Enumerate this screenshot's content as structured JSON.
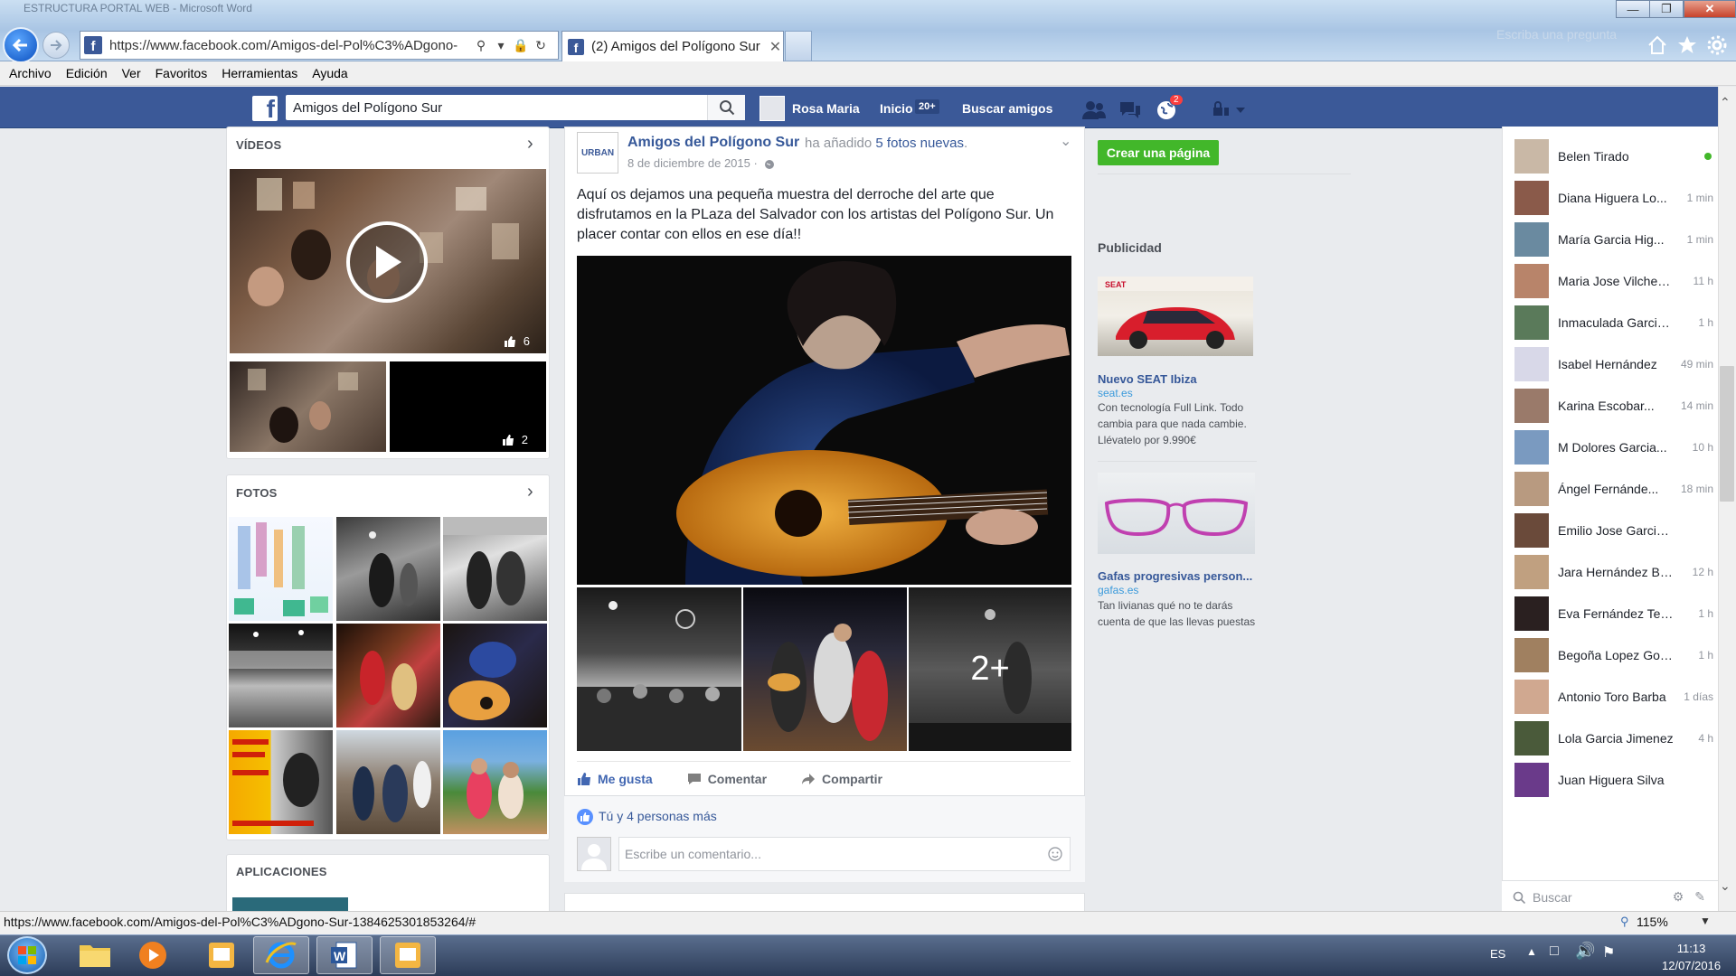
{
  "window": {
    "title": "ESTRUCTURA PORTAL WEB - Microsoft Word"
  },
  "browser": {
    "url": "https://www.facebook.com/Amigos-del-Pol%C3%ADgono-",
    "tab_title": "(2) Amigos del Polígono Sur",
    "ghost_search": "Escriba una pregunta",
    "menu": [
      "Archivo",
      "Edición",
      "Ver",
      "Favoritos",
      "Herramientas",
      "Ayuda"
    ],
    "status_url": "https://www.facebook.com/Amigos-del-Pol%C3%ADgono-Sur-1384625301853264/#",
    "zoom": "115%"
  },
  "fb_header": {
    "search_value": "Amigos del Polígono Sur",
    "user_name": "Rosa Maria",
    "home_label": "Inicio",
    "home_badge": "20+",
    "find_friends": "Buscar amigos",
    "notifications_badge": "2",
    "brand_color": "#3b5998"
  },
  "left_column": {
    "videos_title": "VÍDEOS",
    "video_main_likes": "6",
    "video_second_likes": "2",
    "photos_title": "FOTOS",
    "apps_title": "APLICACIONES"
  },
  "post": {
    "author": "Amigos del Polígono Sur",
    "action_pre": "ha añadido",
    "action_link": "5 fotos nuevas",
    "action_post": ".",
    "date": "8 de diciembre de 2015 ·",
    "text": "Aquí os dejamos una pequeña muestra del derroche del arte que disfrutamos en la PLaza del Salvador con los artistas del Polígono Sur. Un placer contar con ellos en ese día!!",
    "more_photos": "2+",
    "avatar_text": "URBAN",
    "like_label": "Me gusta",
    "comment_label": "Comentar",
    "share_label": "Compartir",
    "likes_summary": "Tú y 4 personas más",
    "comment_placeholder": "Escribe un comentario..."
  },
  "right_column": {
    "create_page": "Crear una página",
    "ads_title": "Publicidad",
    "ads": [
      {
        "title": "Nuevo SEAT Ibiza",
        "url": "seat.es",
        "desc": "Con tecnología Full Link. Todo cambia para que nada cambie. Llévatelo por 9.990€",
        "brand": "SEAT"
      },
      {
        "title": "Gafas progresivas person...",
        "url": "gafas.es",
        "desc": "Tan livianas qué no te darás cuenta de que las llevas puestas"
      }
    ]
  },
  "chat": {
    "friends": [
      {
        "name": "Belen Tirado",
        "time": "",
        "online": true
      },
      {
        "name": "Diana Higuera Lo...",
        "time": "1 min"
      },
      {
        "name": "María Garcia Hig...",
        "time": "1 min"
      },
      {
        "name": "Maria Jose Vilches...",
        "time": "11 h"
      },
      {
        "name": "Inmaculada Garcia...",
        "time": "1 h"
      },
      {
        "name": "Isabel Hernández",
        "time": "49 min"
      },
      {
        "name": "Karina Escobar...",
        "time": "14 min"
      },
      {
        "name": "M Dolores Garcia...",
        "time": "10 h"
      },
      {
        "name": "Ángel Fernánde...",
        "time": "18 min"
      },
      {
        "name": "Emilio Jose Garcia Nunez",
        "time": ""
      },
      {
        "name": "Jara Hernández Br...",
        "time": "12 h"
      },
      {
        "name": "Eva Fernández Terol",
        "time": "1 h"
      },
      {
        "name": "Begoña Lopez Gomez",
        "time": "1 h"
      },
      {
        "name": "Antonio Toro Barba",
        "time": "1 días"
      },
      {
        "name": "Lola Garcia Jimenez",
        "time": "4 h"
      },
      {
        "name": "Juan Higuera Silva",
        "time": ""
      }
    ],
    "search_placeholder": "Buscar"
  },
  "taskbar": {
    "lang": "ES",
    "time": "11:13",
    "date": "12/07/2016"
  }
}
